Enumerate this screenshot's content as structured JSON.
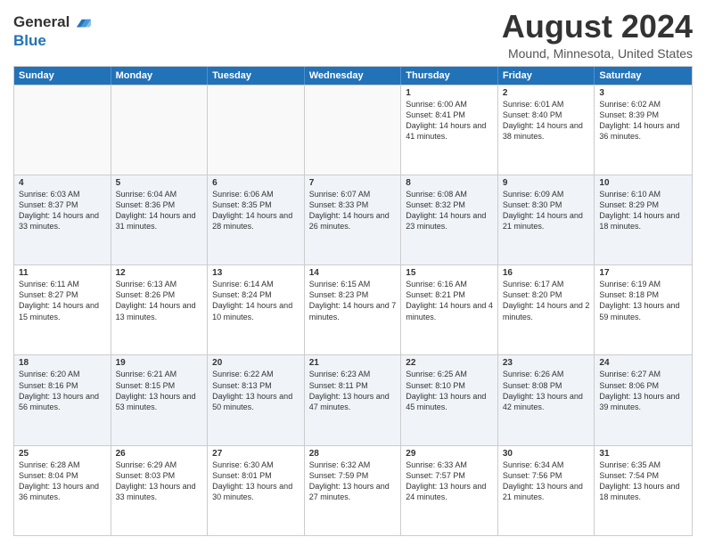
{
  "logo": {
    "general": "General",
    "blue": "Blue"
  },
  "header": {
    "month": "August 2024",
    "location": "Mound, Minnesota, United States"
  },
  "days": [
    "Sunday",
    "Monday",
    "Tuesday",
    "Wednesday",
    "Thursday",
    "Friday",
    "Saturday"
  ],
  "rows": [
    [
      {
        "day": "",
        "empty": true
      },
      {
        "day": "",
        "empty": true
      },
      {
        "day": "",
        "empty": true
      },
      {
        "day": "",
        "empty": true
      },
      {
        "day": "1",
        "sunrise": "6:00 AM",
        "sunset": "8:41 PM",
        "daylight": "14 hours and 41 minutes."
      },
      {
        "day": "2",
        "sunrise": "6:01 AM",
        "sunset": "8:40 PM",
        "daylight": "14 hours and 38 minutes."
      },
      {
        "day": "3",
        "sunrise": "6:02 AM",
        "sunset": "8:39 PM",
        "daylight": "14 hours and 36 minutes."
      }
    ],
    [
      {
        "day": "4",
        "sunrise": "6:03 AM",
        "sunset": "8:37 PM",
        "daylight": "14 hours and 33 minutes."
      },
      {
        "day": "5",
        "sunrise": "6:04 AM",
        "sunset": "8:36 PM",
        "daylight": "14 hours and 31 minutes."
      },
      {
        "day": "6",
        "sunrise": "6:06 AM",
        "sunset": "8:35 PM",
        "daylight": "14 hours and 28 minutes."
      },
      {
        "day": "7",
        "sunrise": "6:07 AM",
        "sunset": "8:33 PM",
        "daylight": "14 hours and 26 minutes."
      },
      {
        "day": "8",
        "sunrise": "6:08 AM",
        "sunset": "8:32 PM",
        "daylight": "14 hours and 23 minutes."
      },
      {
        "day": "9",
        "sunrise": "6:09 AM",
        "sunset": "8:30 PM",
        "daylight": "14 hours and 21 minutes."
      },
      {
        "day": "10",
        "sunrise": "6:10 AM",
        "sunset": "8:29 PM",
        "daylight": "14 hours and 18 minutes."
      }
    ],
    [
      {
        "day": "11",
        "sunrise": "6:11 AM",
        "sunset": "8:27 PM",
        "daylight": "14 hours and 15 minutes."
      },
      {
        "day": "12",
        "sunrise": "6:13 AM",
        "sunset": "8:26 PM",
        "daylight": "14 hours and 13 minutes."
      },
      {
        "day": "13",
        "sunrise": "6:14 AM",
        "sunset": "8:24 PM",
        "daylight": "14 hours and 10 minutes."
      },
      {
        "day": "14",
        "sunrise": "6:15 AM",
        "sunset": "8:23 PM",
        "daylight": "14 hours and 7 minutes."
      },
      {
        "day": "15",
        "sunrise": "6:16 AM",
        "sunset": "8:21 PM",
        "daylight": "14 hours and 4 minutes."
      },
      {
        "day": "16",
        "sunrise": "6:17 AM",
        "sunset": "8:20 PM",
        "daylight": "14 hours and 2 minutes."
      },
      {
        "day": "17",
        "sunrise": "6:19 AM",
        "sunset": "8:18 PM",
        "daylight": "13 hours and 59 minutes."
      }
    ],
    [
      {
        "day": "18",
        "sunrise": "6:20 AM",
        "sunset": "8:16 PM",
        "daylight": "13 hours and 56 minutes."
      },
      {
        "day": "19",
        "sunrise": "6:21 AM",
        "sunset": "8:15 PM",
        "daylight": "13 hours and 53 minutes."
      },
      {
        "day": "20",
        "sunrise": "6:22 AM",
        "sunset": "8:13 PM",
        "daylight": "13 hours and 50 minutes."
      },
      {
        "day": "21",
        "sunrise": "6:23 AM",
        "sunset": "8:11 PM",
        "daylight": "13 hours and 47 minutes."
      },
      {
        "day": "22",
        "sunrise": "6:25 AM",
        "sunset": "8:10 PM",
        "daylight": "13 hours and 45 minutes."
      },
      {
        "day": "23",
        "sunrise": "6:26 AM",
        "sunset": "8:08 PM",
        "daylight": "13 hours and 42 minutes."
      },
      {
        "day": "24",
        "sunrise": "6:27 AM",
        "sunset": "8:06 PM",
        "daylight": "13 hours and 39 minutes."
      }
    ],
    [
      {
        "day": "25",
        "sunrise": "6:28 AM",
        "sunset": "8:04 PM",
        "daylight": "13 hours and 36 minutes."
      },
      {
        "day": "26",
        "sunrise": "6:29 AM",
        "sunset": "8:03 PM",
        "daylight": "13 hours and 33 minutes."
      },
      {
        "day": "27",
        "sunrise": "6:30 AM",
        "sunset": "8:01 PM",
        "daylight": "13 hours and 30 minutes."
      },
      {
        "day": "28",
        "sunrise": "6:32 AM",
        "sunset": "7:59 PM",
        "daylight": "13 hours and 27 minutes."
      },
      {
        "day": "29",
        "sunrise": "6:33 AM",
        "sunset": "7:57 PM",
        "daylight": "13 hours and 24 minutes."
      },
      {
        "day": "30",
        "sunrise": "6:34 AM",
        "sunset": "7:56 PM",
        "daylight": "13 hours and 21 minutes."
      },
      {
        "day": "31",
        "sunrise": "6:35 AM",
        "sunset": "7:54 PM",
        "daylight": "13 hours and 18 minutes."
      }
    ]
  ]
}
